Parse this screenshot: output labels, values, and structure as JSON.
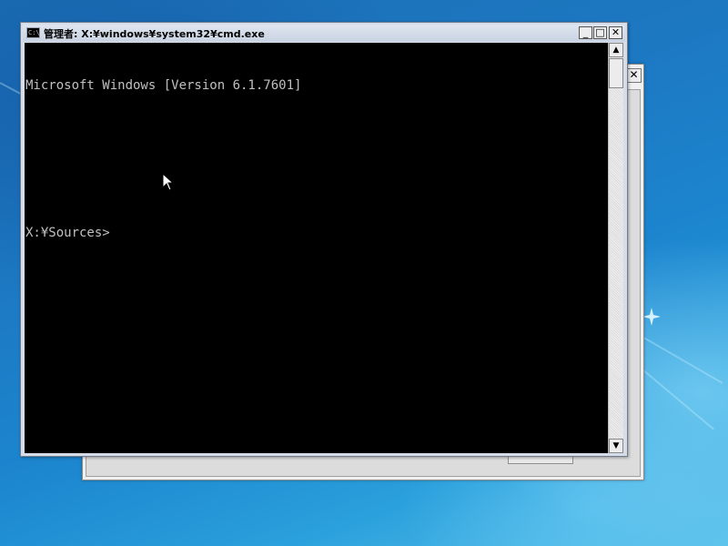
{
  "desktop": {
    "colors": {
      "accent": "#1d78c2",
      "light": "#5cc3ea"
    }
  },
  "background_window": {
    "close_glyph": "✕"
  },
  "cmd_window": {
    "title": "管理者: X:¥windows¥system32¥cmd.exe",
    "icon_label": "C:\\",
    "buttons": {
      "minimize": "_",
      "maximize": "□",
      "close": "✕"
    },
    "console_lines": [
      "Microsoft Windows [Version 6.1.7601]",
      "",
      "",
      "X:¥Sources>"
    ],
    "scrollbar": {
      "up_arrow": "▲",
      "down_arrow": "▼"
    },
    "colors": {
      "console_bg": "#000000",
      "console_text": "#c0c0c0"
    }
  },
  "icons": [
    "console-app-icon",
    "minimize-icon",
    "maximize-icon",
    "close-icon",
    "mouse-pointer-icon"
  ]
}
